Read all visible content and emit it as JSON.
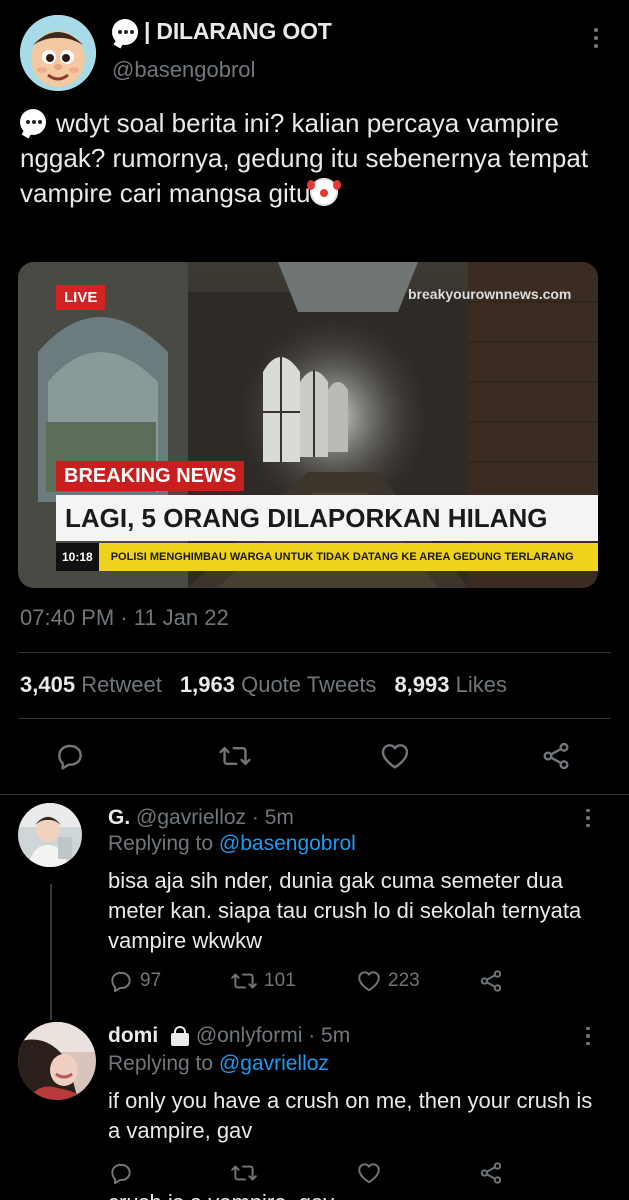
{
  "tweet": {
    "author": {
      "display_name": "| DILARANG OOT",
      "handle": "@basengobrol",
      "avatar": "cartoon-boy-avatar"
    },
    "text_main": "wdyt soal berita ini? kalian percaya vampire nggak? rumornya, gedung itu sebenernya tempat vampire cari mangsa gitu",
    "media": {
      "live_label": "LIVE",
      "source": "breakyourownnews.com",
      "breaking_label": "BREAKING NEWS",
      "headline": "LAGI, 5 ORANG DILAPORKAN HILANG",
      "ticker_time": "10:18",
      "ticker_text": "POLISI MENGHIMBAU WARGA UNTUK TIDAK DATANG KE AREA GEDUNG TERLARANG"
    },
    "timestamp": "07:40 PM · 11 Jan 22",
    "stats": {
      "retweets": "3,405",
      "retweets_label": "Retweet",
      "quotes": "1,963",
      "quotes_label": "Quote Tweets",
      "likes": "8,993",
      "likes_label": "Likes"
    }
  },
  "replies": [
    {
      "name": "G.",
      "handle": "@gavrielloz",
      "time": "· 5m",
      "replying_prefix": "Replying to",
      "replying_to": "@basengobrol",
      "text": "bisa aja sih nder, dunia gak cuma semeter dua meter kan. siapa tau crush lo di sekolah ternyata vampire wkwkw",
      "counts": {
        "replies": "97",
        "retweets": "101",
        "likes": "223"
      }
    },
    {
      "name": "domi",
      "handle": "@onlyformi",
      "time": "· 5m",
      "replying_prefix": "Replying to",
      "replying_to": "@gavrielloz",
      "text": "if only you have a crush on me, then your crush is a vampire, gav"
    }
  ],
  "cutoff_text": "crush is a vampire, gav",
  "colors": {
    "background": "#000000",
    "text": "#e7e9ea",
    "muted": "#71767b",
    "link": "#1d9bf0",
    "divider": "#2f3336"
  }
}
